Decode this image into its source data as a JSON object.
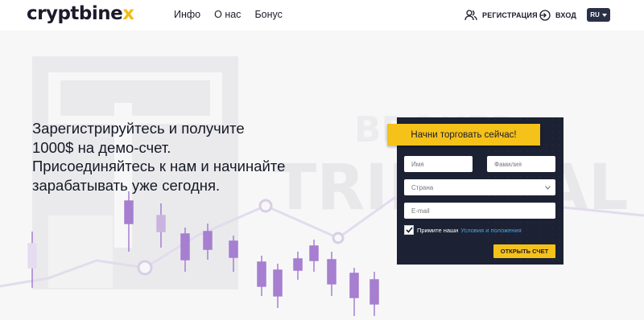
{
  "header": {
    "logo_main": "cryptbine",
    "logo_x": "x",
    "nav": [
      "Инфо",
      "О нас",
      "Бонус"
    ],
    "register_label": "РЕГИСТРАЦИЯ",
    "login_label": "ВХОД",
    "lang_label": "RU",
    "register_icon": "users-icon",
    "login_icon": "login-arrow-icon",
    "lang_icon": "chevron-down-icon"
  },
  "hero": {
    "watermark_text_1": "BROKER",
    "watermark_text_2": "TRIBUNAL",
    "headline": "Зарегистрируйтесь и получите 1000$ на демо-счет. Присоединяйтесь к нам и начинайте зарабатывать уже сегодня."
  },
  "form": {
    "cta": "Начни торговать сейчас!",
    "first_name_placeholder": "Имя",
    "last_name_placeholder": "Фамилия",
    "country_placeholder": "Страна",
    "email_placeholder": "E-mail",
    "terms_text": "Примите наши",
    "terms_link": "Условия и положения",
    "terms_checked": true,
    "submit_label": "ОТКРЫТЬ СЧЕТ"
  },
  "colors": {
    "accent": "#f5c21a",
    "card_bg": "#1c2233",
    "candles": "#9b6fc7",
    "link": "#4aa3e8"
  }
}
